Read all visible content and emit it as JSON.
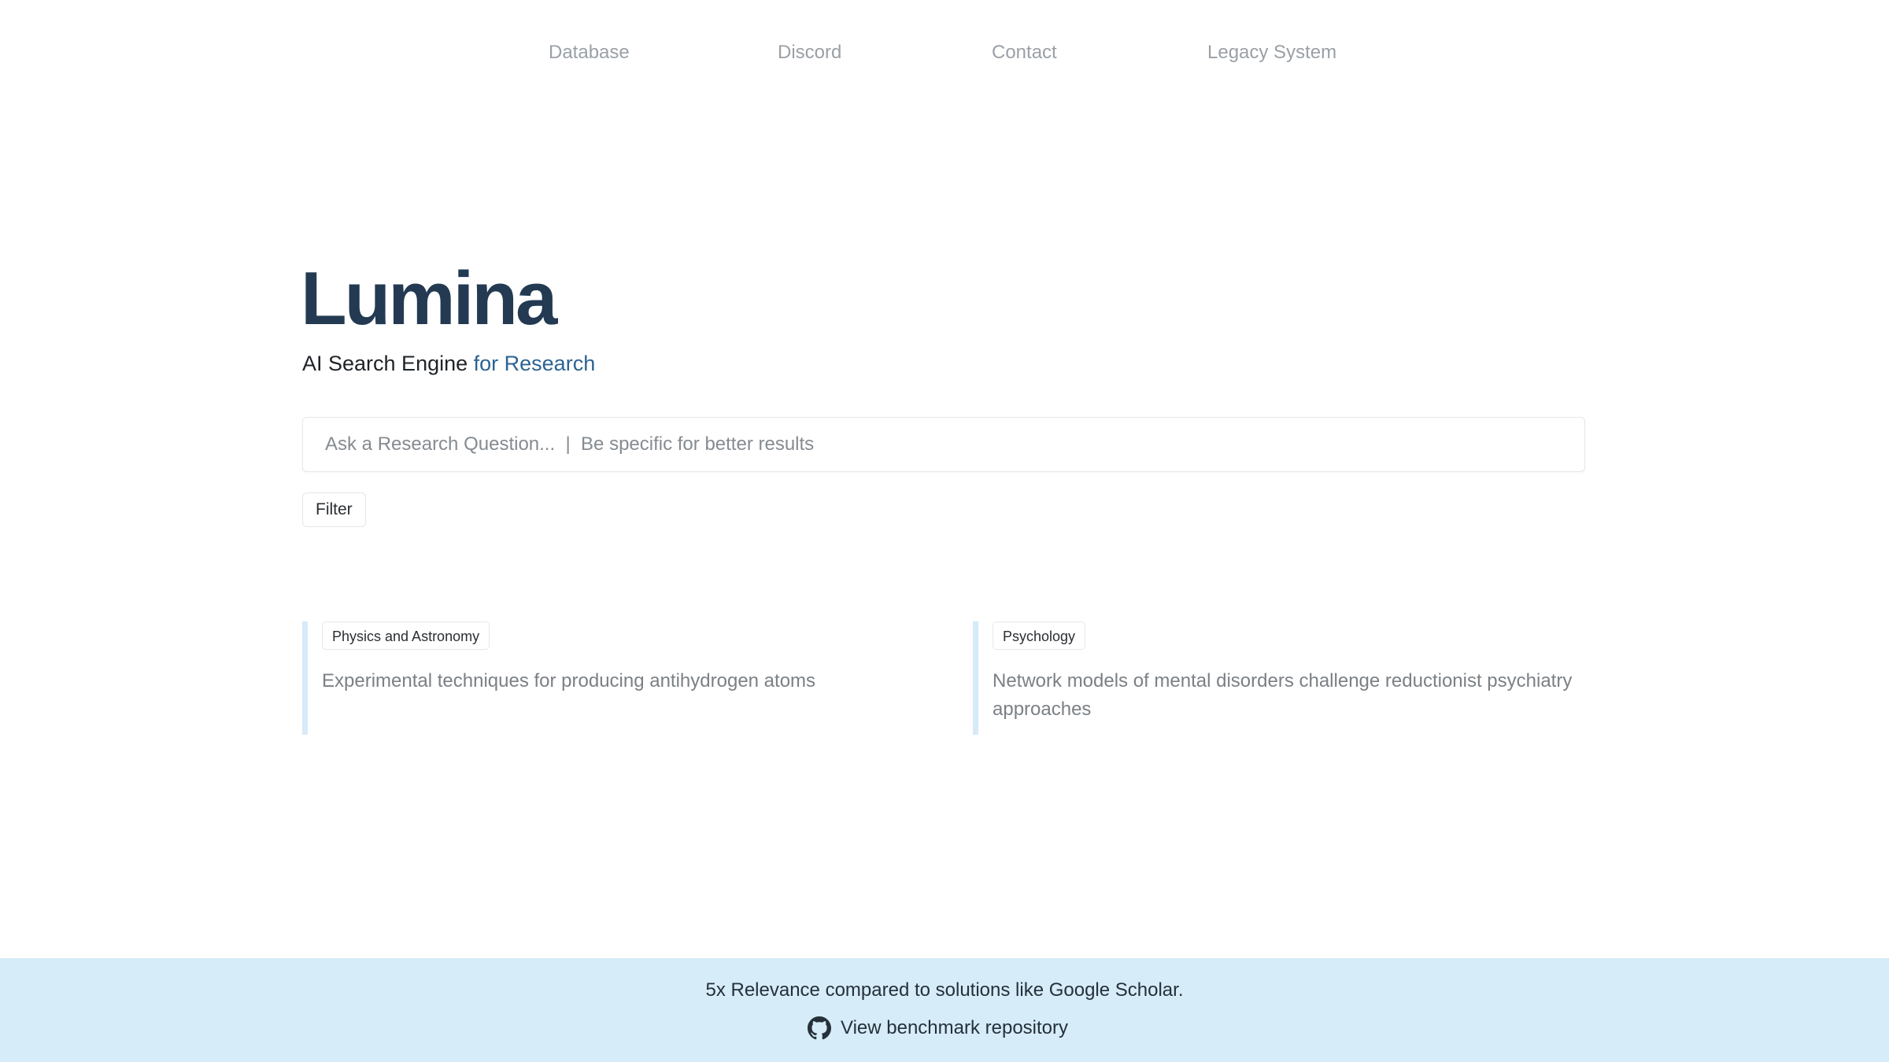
{
  "nav": {
    "items": [
      {
        "label": "Database"
      },
      {
        "label": "Discord"
      },
      {
        "label": "Contact"
      },
      {
        "label": "Legacy System"
      }
    ]
  },
  "hero": {
    "title": "Lumina",
    "tagline_main": "AI Search Engine ",
    "tagline_accent": "for Research"
  },
  "search": {
    "placeholder": "Ask a Research Question...  |  Be specific for better results",
    "value": ""
  },
  "filter": {
    "label": "Filter"
  },
  "examples": [
    {
      "category": "Physics and Astronomy",
      "text": "Experimental techniques for producing antihydrogen atoms"
    },
    {
      "category": "Psychology",
      "text": "Network models of mental disorders challenge reductionist psychiatry approaches"
    }
  ],
  "footer": {
    "text": "5x Relevance compared to solutions like Google Scholar.",
    "link_label": "View benchmark repository",
    "link_icon": "github-icon"
  },
  "colors": {
    "brand_title": "#233a52",
    "accent": "#2b6394",
    "footer_bg": "#d6ecf8",
    "card_border": "#d6eaf8"
  }
}
